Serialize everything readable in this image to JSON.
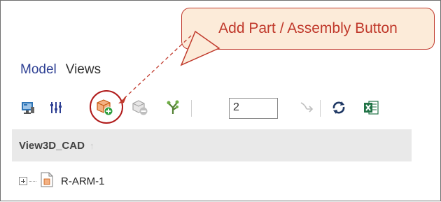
{
  "tabs": [
    {
      "label": "Model",
      "active": true
    },
    {
      "label": "Views",
      "active": false
    }
  ],
  "toolbar": {
    "buttons": [
      {
        "name": "display-icon"
      },
      {
        "name": "filter-icon"
      },
      {
        "name": "add-part-assembly-icon"
      },
      {
        "name": "remove-part-icon"
      },
      {
        "name": "tree-icon"
      },
      {
        "name": "collapse-icon"
      },
      {
        "name": "refresh-icon"
      },
      {
        "name": "excel-icon"
      }
    ],
    "level_value": "2"
  },
  "grid": {
    "column_header": "View3D_CAD",
    "sort_glyph": "↑",
    "rows": [
      {
        "label": "R-ARM-1"
      }
    ]
  },
  "callout": {
    "text": "Add Part / Assembly Button"
  },
  "colors": {
    "accent": "#2d3f93",
    "callout_border": "#c0392b",
    "callout_fill": "#fcebd9",
    "highlight": "#b01a1a",
    "header_bg": "#e9e9e9"
  }
}
